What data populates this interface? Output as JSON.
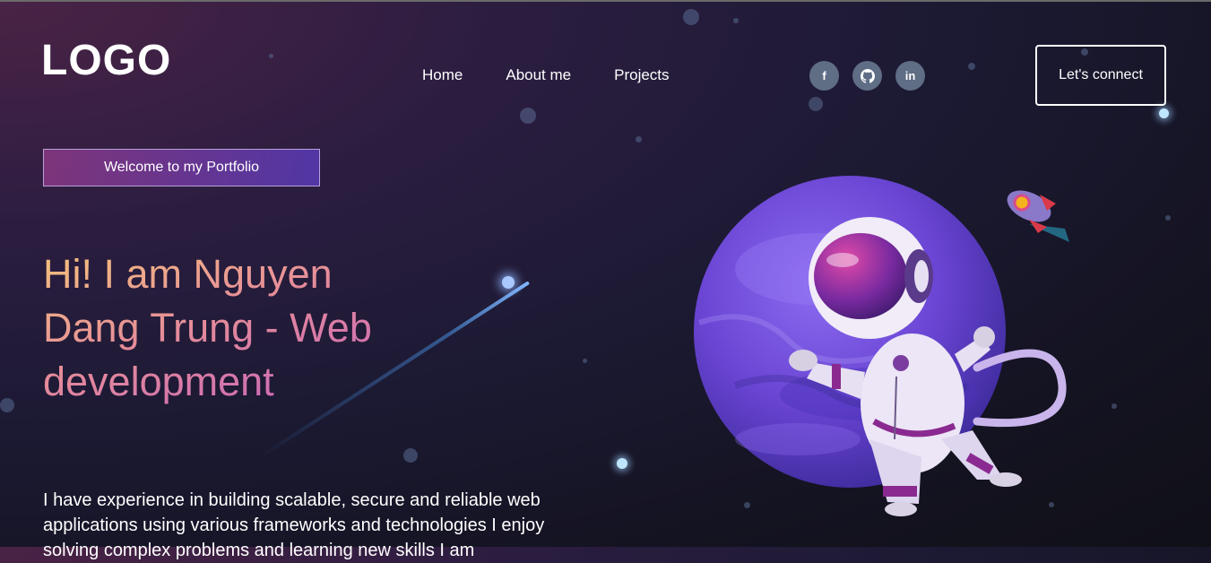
{
  "header": {
    "logo": "LOGO",
    "nav": [
      {
        "label": "Home"
      },
      {
        "label": "About me"
      },
      {
        "label": "Projects"
      }
    ],
    "social": [
      {
        "icon": "facebook-icon",
        "glyph": "f"
      },
      {
        "icon": "github-icon",
        "glyph": "⌂"
      },
      {
        "icon": "linkedin-icon",
        "glyph": "in"
      }
    ],
    "connect_label": "Let's connect"
  },
  "hero": {
    "badge": "Welcome to my Portfolio",
    "headline": "Hi! I am Nguyen Dang Trung - Web development",
    "description": "I have experience in building scalable, secure and reliable web applications using various frameworks and technologies I enjoy solving complex problems and learning new skills I am"
  },
  "colors": {
    "accent_gradient_start": "#f6c47b",
    "accent_gradient_end": "#c05bc4",
    "social_bg": "#5f6d85"
  }
}
